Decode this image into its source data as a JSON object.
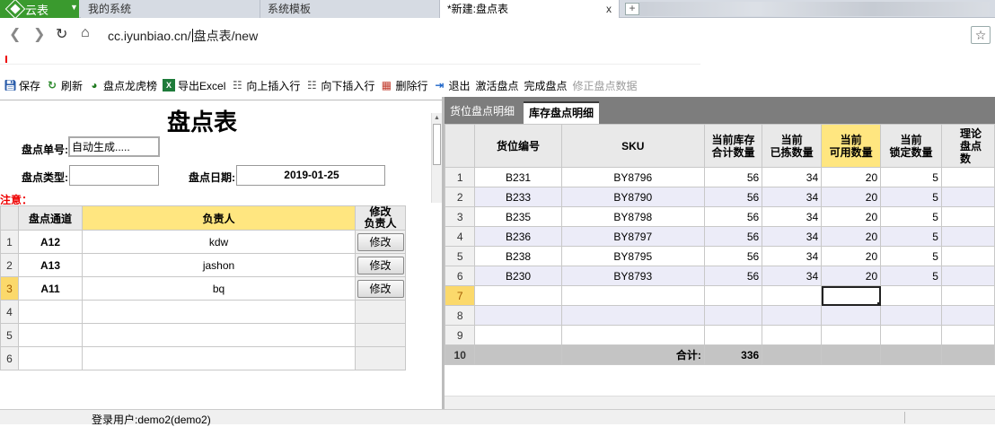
{
  "browser": {
    "app_name": "云表",
    "tabs": [
      {
        "label": "我的系统"
      },
      {
        "label": "系统模板"
      },
      {
        "label": "*新建:盘点表"
      }
    ],
    "url_before": "cc.iyunbiao.cn/",
    "url_after": "盘点表/new",
    "close_glyph": "x",
    "new_tab_glyph": "+"
  },
  "toolbar": {
    "items": [
      {
        "label": "保存",
        "icon": "save-icon"
      },
      {
        "label": "刷新",
        "icon": "refresh-icon"
      },
      {
        "label": "盘点龙虎榜",
        "icon": "chart-icon"
      },
      {
        "label": "导出Excel",
        "icon": "excel-icon"
      },
      {
        "label": "向上插入行",
        "icon": "insert-above-icon"
      },
      {
        "label": "向下插入行",
        "icon": "insert-below-icon"
      },
      {
        "label": "删除行",
        "icon": "delete-row-icon"
      },
      {
        "label": "退出",
        "icon": "exit-icon"
      },
      {
        "label": "激活盘点",
        "icon": ""
      },
      {
        "label": "完成盘点",
        "icon": ""
      },
      {
        "label": "修正盘点数据",
        "icon": "",
        "disabled": true
      }
    ]
  },
  "form": {
    "title": "盘点表",
    "order_no_label": "盘点单号:",
    "order_no_value": "自动生成.....",
    "type_label": "盘点类型:",
    "type_value": "",
    "date_label": "盘点日期:",
    "date_value": "2019-01-25",
    "note_label": "注意："
  },
  "left_grid": {
    "headers": [
      "盘点通道",
      "负责人",
      "修改负责人"
    ],
    "header_line1": "修改",
    "header_line2": "负责人",
    "rows": [
      {
        "num": "1",
        "channel": "A12",
        "person": "kdw",
        "button": "修改"
      },
      {
        "num": "2",
        "channel": "A13",
        "person": "jashon",
        "button": "修改"
      },
      {
        "num": "3",
        "channel": "A11",
        "person": "bq",
        "button": "修改"
      },
      {
        "num": "4",
        "channel": "",
        "person": "",
        "button": ""
      },
      {
        "num": "5",
        "channel": "",
        "person": "",
        "button": ""
      },
      {
        "num": "6",
        "channel": "",
        "person": "",
        "button": ""
      }
    ]
  },
  "right_tabs": [
    {
      "label": "货位盘点明细"
    },
    {
      "label": "库存盘点明细"
    }
  ],
  "right_grid": {
    "headers": [
      [
        "货位编号"
      ],
      [
        "SKU"
      ],
      [
        "当前库存",
        "合计数量"
      ],
      [
        "当前",
        "已拣数量"
      ],
      [
        "当前",
        "可用数量"
      ],
      [
        "当前",
        "锁定数量"
      ],
      [
        "理论",
        "盘点数"
      ]
    ],
    "rows": [
      {
        "num": "1",
        "loc": "B231",
        "sku": "BY8796",
        "total": "56",
        "picked": "34",
        "avail": "20",
        "locked": "5"
      },
      {
        "num": "2",
        "loc": "B233",
        "sku": "BY8790",
        "total": "56",
        "picked": "34",
        "avail": "20",
        "locked": "5"
      },
      {
        "num": "3",
        "loc": "B235",
        "sku": "BY8798",
        "total": "56",
        "picked": "34",
        "avail": "20",
        "locked": "5"
      },
      {
        "num": "4",
        "loc": "B236",
        "sku": "BY8797",
        "total": "56",
        "picked": "34",
        "avail": "20",
        "locked": "5"
      },
      {
        "num": "5",
        "loc": "B238",
        "sku": "BY8795",
        "total": "56",
        "picked": "34",
        "avail": "20",
        "locked": "5"
      },
      {
        "num": "6",
        "loc": "B230",
        "sku": "BY8793",
        "total": "56",
        "picked": "34",
        "avail": "20",
        "locked": "5"
      },
      {
        "num": "7",
        "loc": "",
        "sku": "",
        "total": "",
        "picked": "",
        "avail": "",
        "locked": ""
      },
      {
        "num": "8",
        "loc": "",
        "sku": "",
        "total": "",
        "picked": "",
        "avail": "",
        "locked": ""
      },
      {
        "num": "9",
        "loc": "",
        "sku": "",
        "total": "",
        "picked": "",
        "avail": "",
        "locked": ""
      }
    ],
    "total_row": {
      "num": "10",
      "label": "合计:",
      "value": "336"
    }
  },
  "status": {
    "user_text": "登录用户:demo2(demo2)"
  }
}
